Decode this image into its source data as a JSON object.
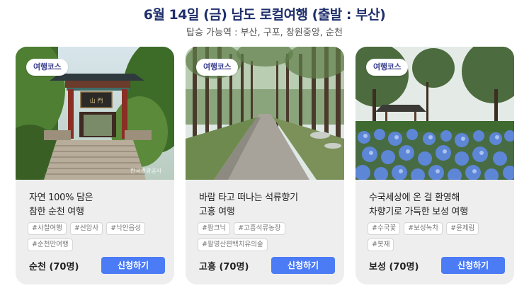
{
  "header": {
    "title": "6월 14일 (금) 남도 로컬여행 (출발 : 부산)",
    "subtitle": "탑승 가능역 :  부산, 구포, 창원중앙, 순천"
  },
  "colors": {
    "title": "#1f2f6b",
    "button": "#4b7bf5",
    "card_bg": "#eeeeee"
  },
  "cards": [
    {
      "badge": "여행코스",
      "photo": "temple-gate-stairs-photo",
      "watermark": "한국관광공사",
      "desc_line1": "자연 100% 담은",
      "desc_line2": "참한 순천 여행",
      "tags": [
        "#사찰여행",
        "#선암사",
        "#낙안읍성",
        "#순천만여행"
      ],
      "capacity": "순천 (70명)",
      "button": "신청하기"
    },
    {
      "badge": "여행코스",
      "photo": "cedar-forest-road-photo",
      "desc_line1": "바람 타고 떠나는 석류향기",
      "desc_line2": "고흥 여행",
      "tags": [
        "#팜크닉",
        "#고흥석류농장",
        "#팔영산편백치유의숲"
      ],
      "capacity": "고흥 (70명)",
      "button": "신청하기"
    },
    {
      "badge": "여행코스",
      "photo": "hydrangea-garden-pavilion-photo",
      "desc_line1": "수국세상에 온 걸 환영해",
      "desc_line2": "차향기로 가득한 보성 여행",
      "tags": [
        "#수국꽃",
        "#보성녹차",
        "#윤제림",
        "#봇재"
      ],
      "capacity": "보성 (70명)",
      "button": "신청하기"
    }
  ]
}
